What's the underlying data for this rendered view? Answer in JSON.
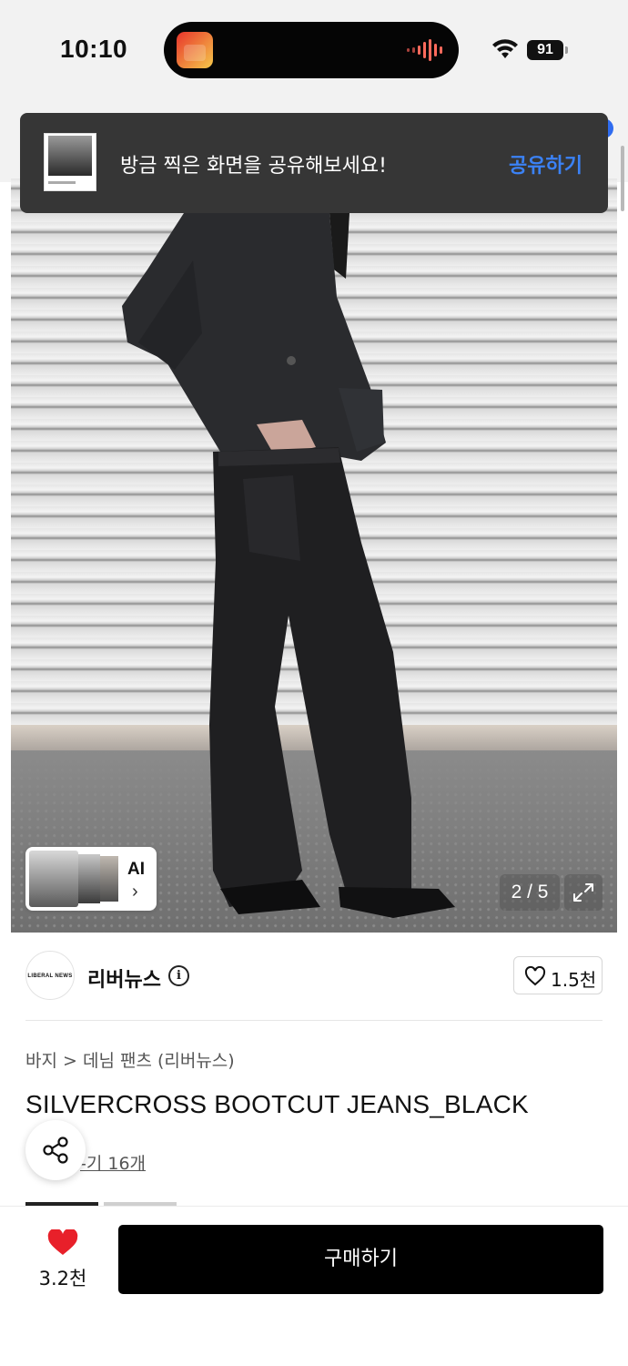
{
  "status_bar": {
    "time": "10:10",
    "battery": "91"
  },
  "toast": {
    "message": "방금 찍은 화면을 공유해보세요!",
    "action": "공유하기"
  },
  "gallery": {
    "ai_label": "AI",
    "ai_chevron": "›",
    "page_counter": "2 / 5"
  },
  "seller": {
    "logo_text": "LIBERAL NEWS",
    "name": "리버뉴스",
    "info_glyph": "i",
    "like_count": "1.5천"
  },
  "product": {
    "breadcrumb": "바지 > 데님 팬츠 (리버뉴스)",
    "title": "SILVERCROSS BOOTCUT JEANS_BLACK",
    "review_link": "-기 16개"
  },
  "bottom": {
    "wish_count": "3.2천",
    "buy_label": "구매하기"
  },
  "colors": {
    "accent_blue": "#3b82f6",
    "heart_red": "#e8202a",
    "buy_button": "#000000"
  },
  "icons": [
    "app-icon",
    "audio-wave-icon",
    "wifi-icon",
    "battery-icon",
    "info-icon",
    "heart-outline-icon",
    "share-icon",
    "expand-icon",
    "chevron-right-icon",
    "heart-filled-icon"
  ]
}
